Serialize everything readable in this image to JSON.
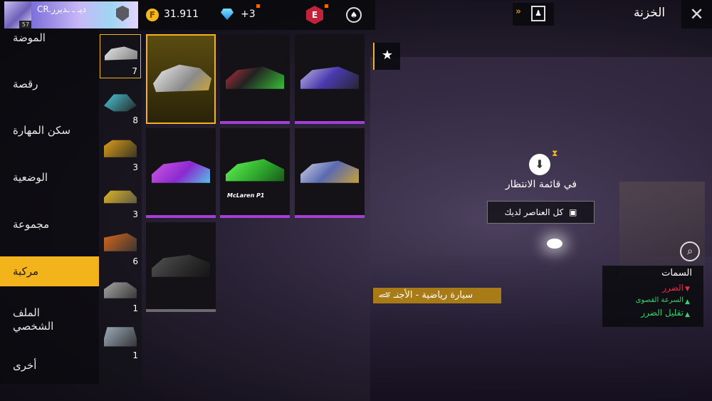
{
  "top_bar": {
    "player_name": "CR.ديـ ـ ـديرر",
    "player_level": "57",
    "gold": "31.911",
    "diamonds": "+3"
  },
  "header": {
    "title": "الخزنة",
    "close": "✕"
  },
  "sidebar": {
    "items": [
      {
        "label": "الموضة"
      },
      {
        "label": "رقصة"
      },
      {
        "label": "سكن المهارة"
      },
      {
        "label": "الوضعية"
      },
      {
        "label": "مجموعة"
      },
      {
        "label": "مركبة",
        "active": true
      },
      {
        "label": "الملف الشخصي"
      },
      {
        "label": "أخرى"
      }
    ]
  },
  "subcategories": [
    {
      "count": "7",
      "selected": true,
      "color": "#e8e8e8"
    },
    {
      "count": "8",
      "color": "#4fd6e8"
    },
    {
      "count": "3",
      "color": "#e8a21a"
    },
    {
      "count": "3",
      "color": "#f0c020"
    },
    {
      "count": "6",
      "color": "#e06a1a"
    },
    {
      "count": "1",
      "color": "#b0b0b0"
    },
    {
      "count": "1",
      "color": "#a0b0c0"
    }
  ],
  "cars": [
    {
      "rarity": "legendary",
      "selected": true,
      "color": "#d8d8d8"
    },
    {
      "rarity": "epic",
      "color": "#c82a3a"
    },
    {
      "rarity": "epic",
      "color": "#5a3fb0"
    },
    {
      "rarity": "epic",
      "color": "#c84fd8"
    },
    {
      "rarity": "epic",
      "color": "#3ad03a",
      "label": "McLaren P1"
    },
    {
      "rarity": "epic",
      "color": "#6a7ab0"
    },
    {
      "rarity": "common",
      "color": "#3a3a3a"
    }
  ],
  "detail": {
    "status": "في قائمة الانتظار",
    "all_items_button": "كل العناصر لديك",
    "item_name": "سيارة رياضية - الأجنـ"
  },
  "attributes": {
    "title": "السمات",
    "items": [
      {
        "label": "الضرر",
        "color": "#e0304a",
        "direction": "down"
      },
      {
        "label": "السرعة القصوى",
        "color": "#3ad06a",
        "direction": "up"
      },
      {
        "label": "تقليل الضرر",
        "color": "#3ad06a",
        "direction": "up"
      }
    ]
  }
}
